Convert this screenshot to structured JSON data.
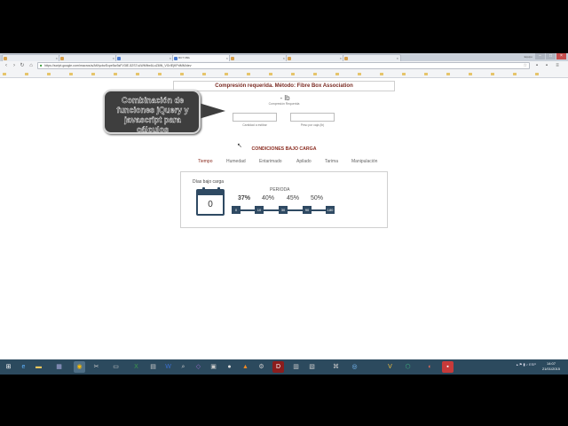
{
  "browser": {
    "tabs": [
      {
        "label": "",
        "active": false,
        "color": "#d7a04b"
      },
      {
        "label": "",
        "active": false,
        "color": "#d7a04b"
      },
      {
        "label": "",
        "active": false,
        "color": "#4a7bd0"
      },
      {
        "label": "RCT FBA",
        "active": true,
        "color": "#4a7bd0"
      },
      {
        "label": "",
        "active": false,
        "color": "#d7a04b"
      },
      {
        "label": "",
        "active": false,
        "color": "#d7a04b"
      },
      {
        "label": "",
        "active": false,
        "color": "#d7a04b"
      }
    ],
    "profile_label": "Equipo",
    "url": "https://script.google.com/macros/s/AKfycbzEcpe5w3sFV3lE-52S7uLWMfbx6LoZ8IN_VGrIEjKPdMM/dev",
    "bookmarks": [
      "",
      "",
      "",
      "",
      "",
      "",
      "",
      "",
      "",
      "",
      "",
      "",
      "",
      "",
      "",
      "",
      "",
      "",
      "",
      "",
      "",
      "",
      "",
      "",
      ""
    ]
  },
  "page": {
    "method_title": "Compresión requerida. Método: Fibre Box Association",
    "weight_value": "- lb",
    "weight_label": "Compresión Requerida",
    "quantity_label": "Cantidad a estibar",
    "weight_per_box_label": "Peso por caja (lb)",
    "conditions_title": "CONDICIONES BAJO CARGA",
    "condition_tabs": [
      "Tiempo",
      "Humedad",
      "Entarimado",
      "Apilado",
      "Tarima",
      "Manipulación"
    ],
    "active_tab": 0,
    "days_label": "Días bajo carga",
    "days_value": "0",
    "period_label": "PERIODA",
    "percentages": [
      "37%",
      "40%",
      "45%",
      "50%"
    ],
    "steps": [
      "0",
      "10",
      "30",
      "90",
      "180"
    ],
    "accent_color": "#8a2b1f",
    "icon_color": "#2f4a63"
  },
  "annotation": {
    "text": "Combinación de funciones jQuery y javascript para cálculos"
  },
  "taskbar": {
    "icons": [
      "windows-icon",
      "ie-icon",
      "folder-icon",
      "control-panel-icon",
      "chrome-icon",
      "tools-icon",
      "monitor-icon",
      "excel-icon",
      "calc-icon",
      "word-icon",
      "search-icon",
      "visual-studio-icon",
      "image-icon",
      "paint-icon",
      "vlc-icon",
      "settings-icon",
      "d-app-icon",
      "chart-icon",
      "photo-icon",
      "network-icon",
      "globe-icon",
      "v-app-icon",
      "xamarin-icon",
      "media-icon",
      "pdf-icon"
    ],
    "tray": "ESP",
    "time": "14:07",
    "date": "21/01/2015"
  }
}
